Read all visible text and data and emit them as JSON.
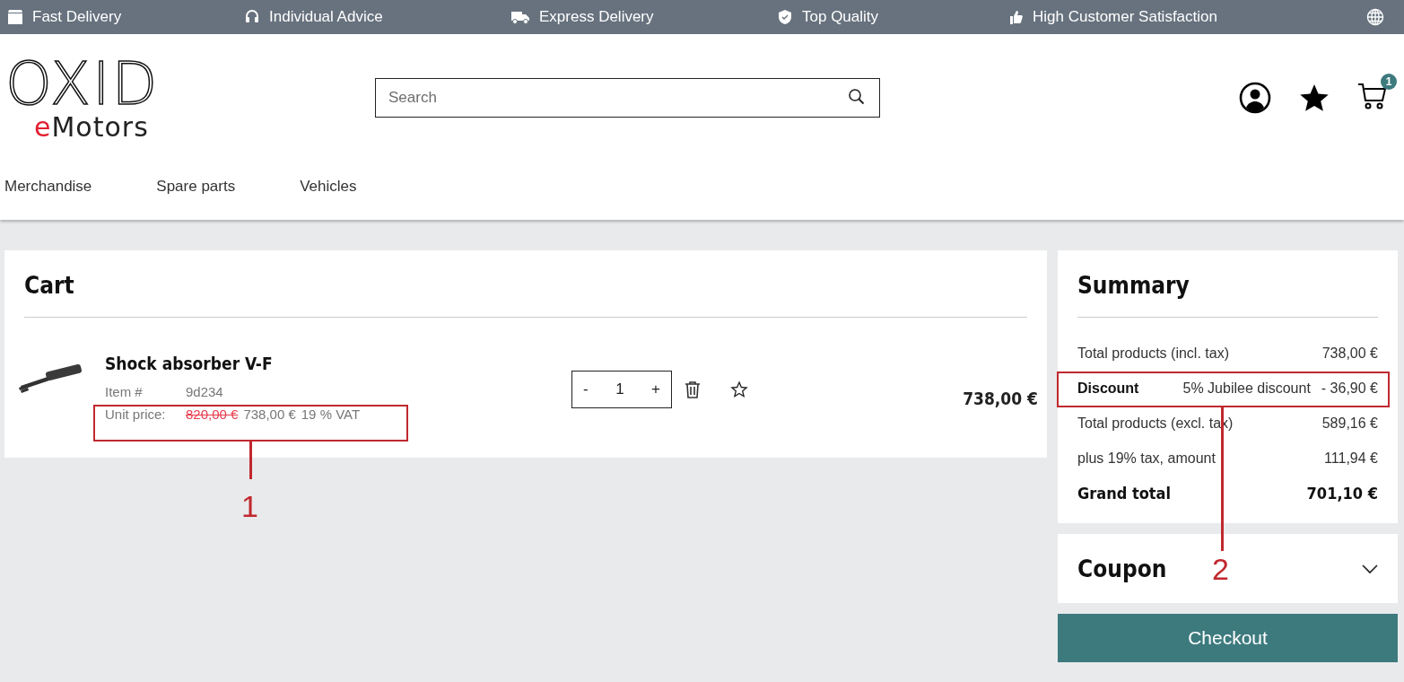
{
  "topbar": {
    "items": [
      {
        "kind": "box",
        "label": "Fast Delivery"
      },
      {
        "kind": "headset",
        "label": "Individual Advice"
      },
      {
        "kind": "truck",
        "label": "Express Delivery"
      },
      {
        "kind": "shield",
        "label": "Top Quality"
      },
      {
        "kind": "thumb",
        "label": "High Customer Satisfaction"
      }
    ]
  },
  "logo": {
    "top": "OXID",
    "bottom": "eMotors"
  },
  "search": {
    "placeholder": "Search"
  },
  "cart_badge": "1",
  "nav": [
    "Merchandise",
    "Spare parts",
    "Vehicles"
  ],
  "cart": {
    "title": "Cart",
    "item": {
      "name": "Shock absorber V-F",
      "item_label": "Item #",
      "item_no": "9d234",
      "price_label": "Unit price:",
      "old_price": "820,00 €",
      "price": "738,00 €",
      "vat": "19 % VAT",
      "qty_minus": "-",
      "quantity": "1",
      "qty_plus": "+",
      "total": "738,00 €"
    }
  },
  "summary": {
    "title": "Summary",
    "rows": [
      {
        "kind": "plain",
        "label": "Total products (incl. tax)",
        "value": "738,00 €"
      },
      {
        "kind": "discount",
        "label": "Discount",
        "note": "5% Jubilee discount",
        "value": "- 36,90 €"
      },
      {
        "kind": "plain",
        "label": "Total products (excl. tax)",
        "value": "589,16 €"
      },
      {
        "kind": "plain",
        "label": "plus 19% tax, amount",
        "value": "111,94 €"
      },
      {
        "kind": "total",
        "label": "Grand total",
        "value": "701,10 €"
      }
    ]
  },
  "coupon": {
    "title": "Coupon",
    "expanded": false
  },
  "checkout": "Checkout",
  "callouts": [
    {
      "kind": "price",
      "number": "1"
    },
    {
      "kind": "discount",
      "number": "2"
    }
  ]
}
